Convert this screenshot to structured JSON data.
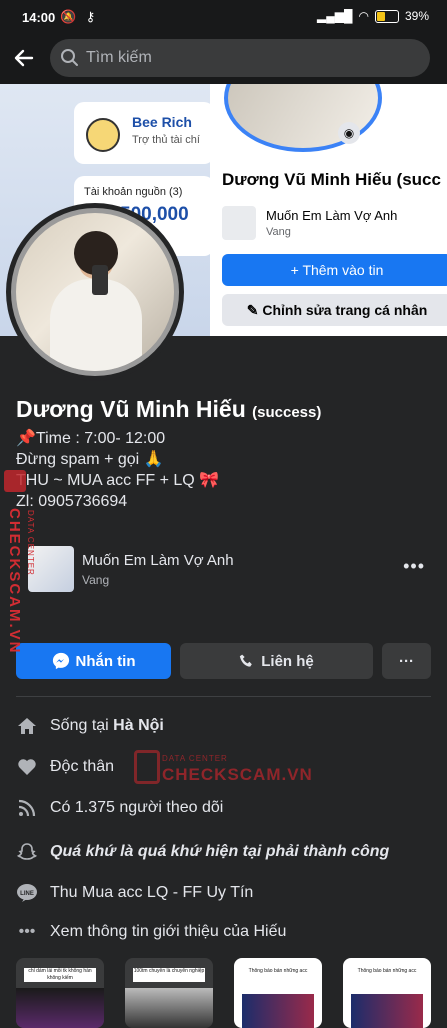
{
  "status_bar": {
    "time": "14:00",
    "battery": "39"
  },
  "search": {
    "placeholder": "Tìm kiếm"
  },
  "cover": {
    "card_title": "Bee Rich",
    "card_subtitle": "Trợ thủ tài chí",
    "account_label": "Tài khoản nguồn (3)",
    "amount": "500,000",
    "preview_name": "Dương Vũ Minh Hiếu (succ",
    "preview_song": "Muốn Em Làm Vợ Anh",
    "preview_song_sub": "Vang",
    "add_story": "+ Thêm vào tin",
    "edit_profile": "✎ Chỉnh sửa trang cá nhân"
  },
  "profile": {
    "name": "Dương Vũ Minh Hiếu",
    "name_suffix": "(success)",
    "bio": [
      "📌Time : 7:00- 12:00",
      "Đừng spam + gọi 🙏",
      "THU ~ MUA acc FF + LQ 🎀",
      "Zl: 0905736694"
    ]
  },
  "song": {
    "title": "Muốn Em Làm Vợ Anh",
    "subtitle": "Vang"
  },
  "actions": {
    "message": "Nhắn tin",
    "contact": "Liên hệ",
    "more": "···"
  },
  "intro": {
    "lives_prefix": "Sống tại ",
    "lives_city": "Hà Nội",
    "relationship": "Độc thân",
    "followers": "Có 1.375 người theo dõi",
    "quote": "Quá khứ là quá khứ hiện tại phải thành công",
    "line": "Thu Mua acc LQ - FF Uy Tín",
    "see_more": "Xem thông tin giới thiệu của Hiếu"
  },
  "thumbs": [
    {
      "caption": "chỉ dám lái mỗi tk không hàn không kiếm"
    },
    {
      "caption": "100tm chuyên là chuyên nghiệp"
    },
    {
      "caption": "Thông báo bán những acc"
    },
    {
      "caption": "Thông báo bán những acc"
    }
  ],
  "watermark": {
    "brand": "CHECKSCAM.VN",
    "sub": "DATA CENTER"
  },
  "colors": {
    "accent": "#1877f2",
    "bg": "#242526",
    "watermark": "#c0272d"
  }
}
